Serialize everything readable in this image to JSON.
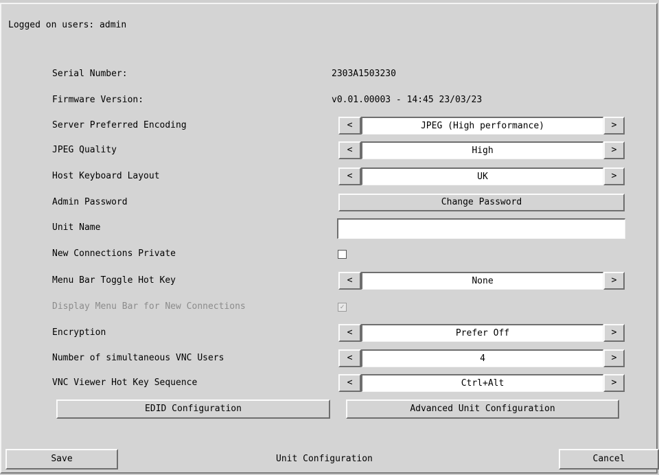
{
  "header": {
    "logged_on": "Logged on users: admin"
  },
  "serial": {
    "label": "Serial Number:",
    "value": "2303A1503230"
  },
  "firmware": {
    "label": "Firmware Version:",
    "value": "v0.01.00003 - 14:45 23/03/23"
  },
  "settings": {
    "encoding": {
      "label": "Server Preferred Encoding",
      "value": "JPEG (High performance)"
    },
    "jpeg_quality": {
      "label": "JPEG Quality",
      "value": "High"
    },
    "keyboard": {
      "label": "Host Keyboard Layout",
      "value": "UK"
    },
    "admin_password": {
      "label": "Admin Password",
      "button": "Change Password"
    },
    "unit_name": {
      "label": "Unit Name",
      "value": ""
    },
    "new_private": {
      "label": "New Connections Private",
      "checked": false
    },
    "menu_toggle": {
      "label": "Menu Bar Toggle Hot Key",
      "value": "None"
    },
    "display_menu": {
      "label": "Display Menu Bar for New Connections",
      "checked": true,
      "disabled": true
    },
    "encryption": {
      "label": "Encryption",
      "value": "Prefer Off"
    },
    "vnc_users": {
      "label": "Number of simultaneous VNC Users",
      "value": "4"
    },
    "vnc_hotkey": {
      "label": "VNC Viewer Hot Key Sequence",
      "value": "Ctrl+Alt"
    }
  },
  "arrows": {
    "left": "<",
    "right": ">",
    "check": "✓"
  },
  "buttons": {
    "edid": "EDID Configuration",
    "advanced": "Advanced Unit Configuration",
    "save": "Save",
    "cancel": "Cancel"
  },
  "footer": {
    "title": "Unit Configuration"
  }
}
